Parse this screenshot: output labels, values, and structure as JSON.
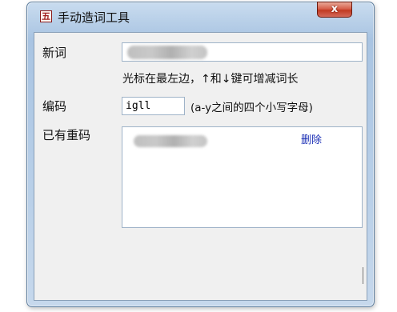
{
  "window": {
    "title": "手动造词工具",
    "icon_glyph": "五",
    "close_glyph": "x"
  },
  "form": {
    "new_word_label": "新词",
    "new_word_value": "",
    "cursor_hint": "光标在最左边，↑和↓键可增减词长",
    "code_label": "编码",
    "code_value": "igll",
    "code_range_hint": "(a-y之间的四个小写字母)",
    "duplicates_label": "已有重码",
    "duplicates": [
      {
        "word": "",
        "delete_label": "删除"
      }
    ]
  },
  "colors": {
    "link": "#1b2fb5",
    "close_button": "#c13a22"
  }
}
